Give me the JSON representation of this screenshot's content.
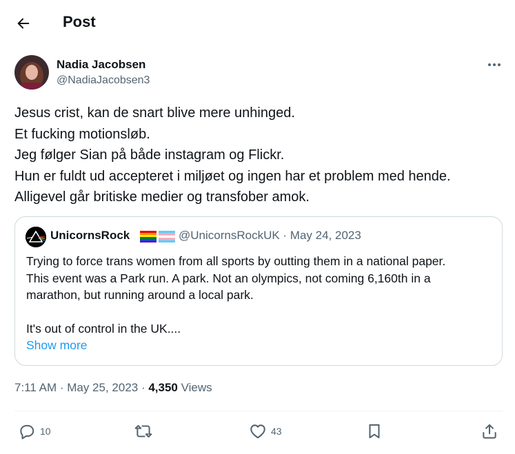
{
  "header": {
    "title": "Post",
    "back_icon": "arrow-left-icon"
  },
  "post": {
    "author_name": "Nadia Jacobsen",
    "author_handle": "@NadiaJacobsen3",
    "text_lines": [
      "Jesus crist, kan de snart blive mere unhinged.",
      "Et fucking motionsløb.",
      "Jeg følger Sian på både instagram og Flickr.",
      "Hun er fuldt ud accepteret i miljøet og ingen har et problem med hende.",
      "Alligevel går britiske medier og transfober amok."
    ],
    "time": "7:11 AM · May 25, 2023 · ",
    "views_count": "4,350",
    "views_label": " Views"
  },
  "quote": {
    "name": "UnicornsRock",
    "meta": "@UnicornsRockUK · May 24, 2023",
    "text_lines": [
      "Trying to force trans women from all sports by outting them in a national paper.",
      "This event was a Park run. A park. Not an olympics, not coming 6,160th in a",
      "marathon, but running around a local park.",
      "",
      "It's out of control in the UK...."
    ],
    "show_more": "Show more"
  },
  "actions": {
    "reply_count": "10",
    "repost_count": "",
    "like_count": "43"
  },
  "colors": {
    "text": "#0f1419",
    "secondary": "#536471",
    "link": "#1d9bf0",
    "border": "#cfd9de"
  }
}
